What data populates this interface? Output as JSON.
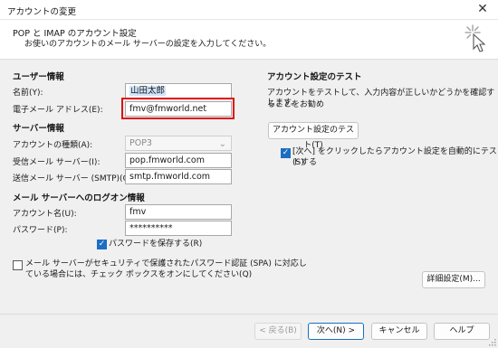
{
  "window": {
    "title": "アカウントの変更",
    "close_glyph": "✕"
  },
  "header": {
    "title": "POP と IMAP のアカウント設定",
    "subtitle": "お使いのアカウントのメール サーバーの設定を入力してください。",
    "icon": "sparkle-cursor-icon"
  },
  "user_info": {
    "heading": "ユーザー情報",
    "name_label": "名前(Y):",
    "name_value": "山田太郎",
    "email_label": "電子メール アドレス(E):",
    "email_value": "fmv@fmworld.net"
  },
  "server_info": {
    "heading": "サーバー情報",
    "account_type_label": "アカウントの種類(A):",
    "account_type_value": "POP3",
    "incoming_label": "受信メール サーバー(I):",
    "incoming_value": "pop.fmworld.com",
    "outgoing_label": "送信メール サーバー (SMTP)(O):",
    "outgoing_value": "smtp.fmworld.com"
  },
  "logon_info": {
    "heading": "メール サーバーへのログオン情報",
    "account_name_label": "アカウント名(U):",
    "account_name_value": "fmv",
    "password_label": "パスワード(P):",
    "password_value": "**********",
    "save_password_label": "パスワードを保存する(R)",
    "save_password_checked": true,
    "spa_label_line1": "メール サーバーがセキュリティで保護されたパスワード認証 (SPA) に対応し",
    "spa_label_line2": "ている場合には、チェック ボックスをオンにしてください(Q)",
    "spa_checked": false
  },
  "test_settings": {
    "heading": "アカウント設定のテスト",
    "description_line1": "アカウントをテストして、入力内容が正しいかどうかを確認することをお勧め",
    "description_line2": "します。",
    "test_button": "アカウント設定のテスト(T)",
    "auto_test_line1": "[次へ] をクリックしたらアカウント設定を自動的にテストする",
    "auto_test_line2": "(S)",
    "auto_test_checked": true,
    "check_glyph": "✓"
  },
  "more_settings_button": "詳細設定(M)...",
  "footer": {
    "back_button": "< 戻る(B)",
    "next_button": "次へ(N) >",
    "cancel_button": "キャンセル",
    "help_button": "ヘルプ"
  },
  "colors": {
    "accent": "#1b6ec2",
    "highlight_border": "#e01010",
    "selection": "#cfe4f9"
  }
}
